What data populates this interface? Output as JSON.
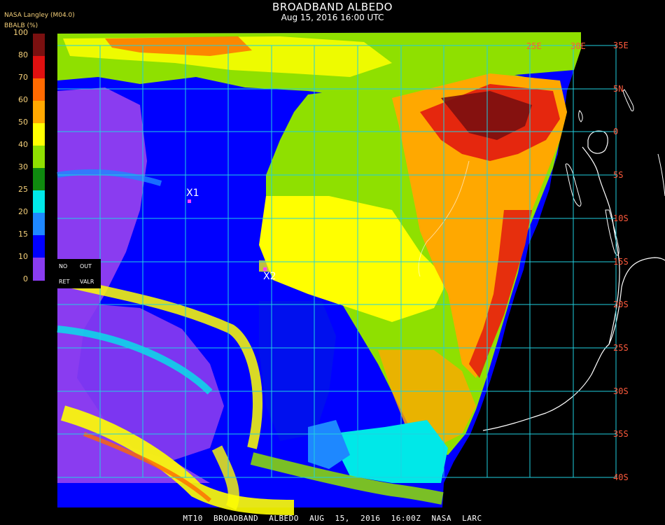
{
  "header": {
    "title": "BROADBAND ALBEDO",
    "subtitle": "Aug 15, 2016 16:00 UTC",
    "producer": "NASA Langley (M04.0)",
    "product": "BBALB (%)"
  },
  "colorbar": {
    "ticks": [
      "100",
      "80",
      "70",
      "60",
      "50",
      "40",
      "30",
      "25",
      "20",
      "15",
      "10",
      "0"
    ],
    "bins": [
      {
        "range": "80-100",
        "color": "#7a1010"
      },
      {
        "range": "70-80",
        "color": "#e01010"
      },
      {
        "range": "60-70",
        "color": "#ff6a00"
      },
      {
        "range": "50-60",
        "color": "#ffa800"
      },
      {
        "range": "40-50",
        "color": "#ffff00"
      },
      {
        "range": "30-40",
        "color": "#8fe000"
      },
      {
        "range": "25-30",
        "color": "#0f8a0f"
      },
      {
        "range": "20-25",
        "color": "#00e8e8"
      },
      {
        "range": "15-20",
        "color": "#1e88ff"
      },
      {
        "range": "10-15",
        "color": "#0000ff"
      },
      {
        "range": "0-10",
        "color": "#8a3cf0"
      }
    ]
  },
  "legend_box": {
    "no": "NO",
    "out": "OUT",
    "ret": "RET",
    "valr": "VALR"
  },
  "grid": {
    "color": "#20d0e0",
    "lon_labels": [
      "35E",
      "5N",
      "0",
      "5S",
      "10S",
      "15S",
      "20S",
      "25S",
      "30S",
      "35S",
      "40S"
    ],
    "top_lon_labels": [
      "25E",
      "30E"
    ]
  },
  "markers": [
    {
      "label": "X1",
      "dot_color": "#ff40ff"
    },
    {
      "label": "X2",
      "dot_color": "#ff40ff"
    }
  ],
  "footer": {
    "items": [
      "MT10",
      "BROADBAND ALBEDO",
      "AUG 15, 2016 16:00Z",
      "NASA LARC"
    ]
  }
}
